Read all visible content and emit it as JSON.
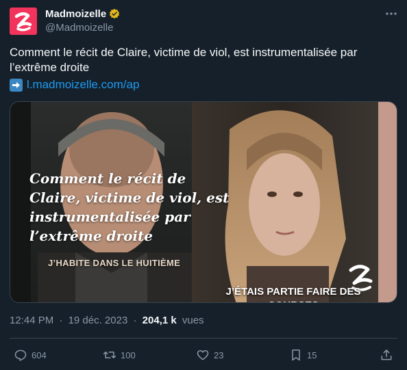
{
  "author": {
    "display_name": "Madmoizelle",
    "handle": "@Madmoizelle",
    "avatar_color": "#f2345c",
    "verified_badge_color": "#e2b719"
  },
  "tweet": {
    "text": "Comment le récit de Claire, victime de viol, est instrumentalisée par l’extrême droite",
    "link_text": "l.madmoizelle.com/ap",
    "link_emoji": "right-arrow-emoji"
  },
  "media": {
    "overlay_title": "Comment le récit de Claire, victime de viol, est instrumentalisée par l’extrême droite",
    "caption_left": "J’HABITE DANS LE HUITIÈME",
    "caption_right": "J’ÉTAIS PARTIE FAIRE DES COURSES"
  },
  "meta": {
    "time": "12:44 PM",
    "separator": "·",
    "date": "19 déc. 2023",
    "views_count": "204,1 k",
    "views_label": "vues"
  },
  "actions": {
    "replies": "604",
    "retweets": "100",
    "likes": "23",
    "bookmarks": "15"
  },
  "colors": {
    "background": "#15202b",
    "text": "#f7f9f9",
    "secondary": "#8b98a5",
    "link": "#1d9bf0",
    "border": "#38444d"
  }
}
